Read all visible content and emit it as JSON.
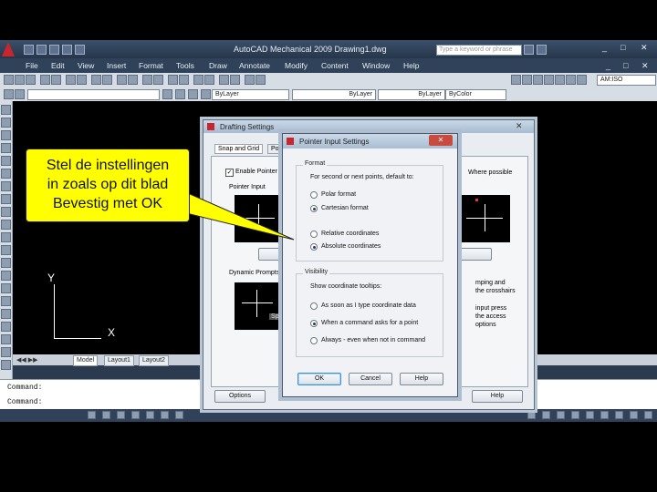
{
  "window": {
    "title": "AutoCAD Mechanical 2009 Drawing1.dwg",
    "search_placeholder": "Type a keyword or phrase"
  },
  "menu": [
    "File",
    "Edit",
    "View",
    "Insert",
    "Format",
    "Tools",
    "Draw",
    "Annotate",
    "Modify",
    "Content",
    "Window",
    "Help"
  ],
  "toolbar": {
    "scale_label": "AM:ISO",
    "layer_combo": "ByLayer",
    "linetype_combo": "ByLayer",
    "lineweight_combo": "ByLayer",
    "color_combo": "ByColor"
  },
  "layout_tabs": [
    "Model",
    "Layout1",
    "Layout2"
  ],
  "command_lines": [
    "Command:",
    "Command:"
  ],
  "drafting_dialog": {
    "title": "Drafting Settings",
    "tabs": [
      "Snap and Grid",
      "Pola"
    ],
    "enable_checkbox": "Enable Pointer",
    "pointer_input_group": "Pointer Input",
    "dynamic_prompts_group": "Dynamic Prompts",
    "right_text_1": "Where possible",
    "right_text_2": "mping and the crosshairs",
    "right_text_3": "input press the access options",
    "spec_btn": "Spe",
    "options_button": "Options",
    "help_button": "Help"
  },
  "pointer_dialog": {
    "title": "Pointer Input Settings",
    "format_group": "Format",
    "format_desc": "For second or next points, default to:",
    "polar": "Polar format",
    "cartesian": "Cartesian format",
    "relative": "Relative coordinates",
    "absolute": "Absolute coordinates",
    "visibility_group": "Visibility",
    "visibility_desc": "Show coordinate tooltips:",
    "vis1": "As soon as I type coordinate data",
    "vis2": "When a command asks for a point",
    "vis3": "Always - even when not in command",
    "ok": "OK",
    "cancel": "Cancel",
    "help": "Help",
    "close": "✕"
  },
  "callout": {
    "line1": "Stel de instellingen",
    "line2": "in zoals op dit blad",
    "line3": "Bevestig met OK"
  },
  "ucs": {
    "y": "Y",
    "x": "X"
  },
  "colors": {
    "callout": "#ffff00",
    "drawing_bg": "#000000"
  }
}
